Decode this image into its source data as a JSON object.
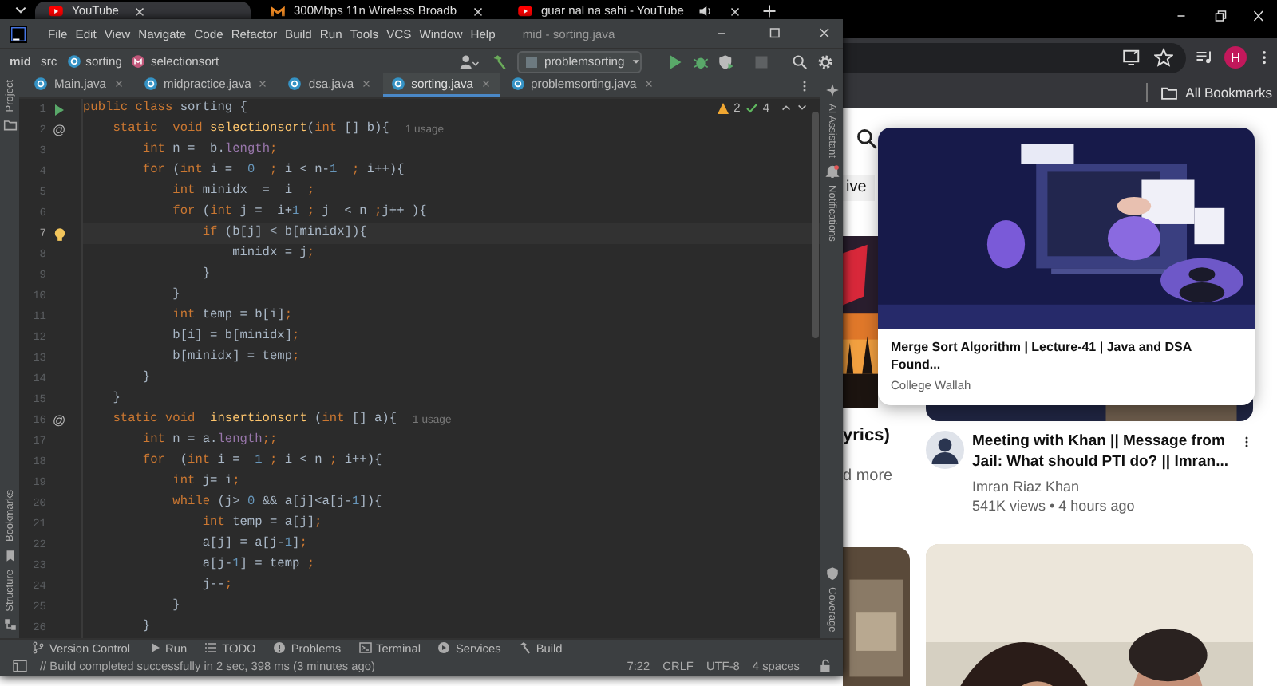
{
  "browser": {
    "tabs": [
      {
        "title": "YouTube",
        "kind": "youtube",
        "selected": true,
        "playing": false
      },
      {
        "title": "300Mbps 11n Wireless Broadb",
        "kind": "site",
        "selected": false,
        "playing": false
      },
      {
        "title": "guar nal na sahi - YouTube",
        "kind": "youtube",
        "selected": false,
        "playing": true
      }
    ],
    "bookmarks": [
      {
        "label": "All Bookmarks"
      }
    ],
    "profile": "H",
    "page": {
      "left_column": [
        {
          "kind": "chip",
          "text": "ive"
        },
        {
          "kind": "picture"
        },
        {
          "kind": "title",
          "text": "yrics)"
        },
        {
          "kind": "more",
          "text": "d more"
        },
        {
          "kind": "picture"
        }
      ],
      "main_column": [
        {
          "kind": "picture"
        },
        {
          "kind": "video",
          "title": "Meeting with Khan || Message from Jail: What should PTI do? || Imran...",
          "channel": "Imran Riaz Khan",
          "meta": "541K views • 4 hours ago"
        },
        {
          "kind": "picture"
        }
      ],
      "hover_card": {
        "title": "Merge Sort Algorithm | Lecture-41 | Java and DSA Found...",
        "channel": "College Wallah"
      }
    }
  },
  "ide": {
    "title": "mid - sorting.java",
    "menu": [
      "File",
      "Edit",
      "View",
      "Navigate",
      "Code",
      "Refactor",
      "Build",
      "Run",
      "Tools",
      "VCS",
      "Window",
      "Help"
    ],
    "breadcrumbs": [
      {
        "label": "mid",
        "kind": "project"
      },
      {
        "label": "src",
        "kind": "folder"
      },
      {
        "label": "sorting",
        "kind": "class"
      },
      {
        "label": "selectionsort",
        "kind": "method"
      }
    ],
    "run_config": "problemsorting",
    "tabs": [
      {
        "label": "Main.java",
        "selected": false
      },
      {
        "label": "midpractice.java",
        "selected": false
      },
      {
        "label": "dsa.java",
        "selected": false
      },
      {
        "label": "sorting.java",
        "selected": true
      },
      {
        "label": "problemsorting.java",
        "selected": false
      }
    ],
    "left_tools": [
      {
        "label": "Project",
        "kind": "project"
      },
      {
        "label": "Bookmarks",
        "kind": "bookmarks"
      },
      {
        "label": "Structure",
        "kind": "structure"
      }
    ],
    "right_tools": [
      {
        "label": "AI Assistant",
        "kind": "ai"
      },
      {
        "label": "Notifications",
        "kind": "notifications"
      },
      {
        "label": "Coverage",
        "kind": "coverage"
      }
    ],
    "inspections": {
      "warnings": "2",
      "passed": "4"
    },
    "lines": [
      {
        "number": "1",
        "kind": "run",
        "current": false,
        "tokens": [
          {
            "kind": "k",
            "text": "public class "
          },
          {
            "kind": "p",
            "text": "sorting {"
          }
        ]
      },
      {
        "number": "2",
        "kind": "plain",
        "current": false,
        "mark": "@",
        "hint": "1 usage",
        "tokens": [
          {
            "kind": "k",
            "text": "    static  void "
          },
          {
            "kind": "m",
            "text": "selectionsort"
          },
          {
            "kind": "p",
            "text": "("
          },
          {
            "kind": "k",
            "text": "int"
          },
          {
            "kind": "p",
            "text": " [] b){"
          }
        ]
      },
      {
        "number": "3",
        "kind": "plain",
        "current": false,
        "tokens": [
          {
            "kind": "k",
            "text": "        int "
          },
          {
            "kind": "p",
            "text": "n =  b."
          },
          {
            "kind": "f",
            "text": "length"
          },
          {
            "kind": "k",
            "text": ";"
          }
        ]
      },
      {
        "number": "4",
        "kind": "plain",
        "current": false,
        "tokens": [
          {
            "kind": "k",
            "text": "        for "
          },
          {
            "kind": "p",
            "text": "("
          },
          {
            "kind": "k",
            "text": "int "
          },
          {
            "kind": "p",
            "text": "i =  "
          },
          {
            "kind": "n",
            "text": "0"
          },
          {
            "kind": "k",
            "text": "  ;"
          },
          {
            "kind": "p",
            "text": " i < n-"
          },
          {
            "kind": "n",
            "text": "1"
          },
          {
            "kind": "k",
            "text": "  ;"
          },
          {
            "kind": "p",
            "text": " i++){"
          }
        ]
      },
      {
        "number": "5",
        "kind": "plain",
        "current": false,
        "tokens": [
          {
            "kind": "k",
            "text": "            int "
          },
          {
            "kind": "p",
            "text": "minidx  =  i  "
          },
          {
            "kind": "k",
            "text": ";"
          }
        ]
      },
      {
        "number": "6",
        "kind": "plain",
        "current": false,
        "tokens": [
          {
            "kind": "k",
            "text": "            for "
          },
          {
            "kind": "p",
            "text": "("
          },
          {
            "kind": "k",
            "text": "int "
          },
          {
            "kind": "p",
            "text": "j =  i+"
          },
          {
            "kind": "n",
            "text": "1"
          },
          {
            "kind": "k",
            "text": " ;"
          },
          {
            "kind": "p",
            "text": " j  < n "
          },
          {
            "kind": "k",
            "text": ";"
          },
          {
            "kind": "p",
            "text": "j++ ){"
          }
        ]
      },
      {
        "number": "7",
        "kind": "bulb",
        "current": true,
        "tokens": [
          {
            "kind": "k",
            "text": "                if "
          },
          {
            "kind": "p",
            "text": "(b[j] < b[minidx]){"
          }
        ]
      },
      {
        "number": "8",
        "kind": "plain",
        "current": false,
        "tokens": [
          {
            "kind": "p",
            "text": "                    minidx = j"
          },
          {
            "kind": "k",
            "text": ";"
          }
        ]
      },
      {
        "number": "9",
        "kind": "plain",
        "current": false,
        "tokens": [
          {
            "kind": "p",
            "text": "                }"
          }
        ]
      },
      {
        "number": "10",
        "kind": "plain",
        "current": false,
        "tokens": [
          {
            "kind": "p",
            "text": "            }"
          }
        ]
      },
      {
        "number": "11",
        "kind": "plain",
        "current": false,
        "tokens": [
          {
            "kind": "k",
            "text": "            int "
          },
          {
            "kind": "p",
            "text": "temp = b[i]"
          },
          {
            "kind": "k",
            "text": ";"
          }
        ]
      },
      {
        "number": "12",
        "kind": "plain",
        "current": false,
        "tokens": [
          {
            "kind": "p",
            "text": "            b[i] = b[minidx]"
          },
          {
            "kind": "k",
            "text": ";"
          }
        ]
      },
      {
        "number": "13",
        "kind": "plain",
        "current": false,
        "tokens": [
          {
            "kind": "p",
            "text": "            b[minidx] = temp"
          },
          {
            "kind": "k",
            "text": ";"
          }
        ]
      },
      {
        "number": "14",
        "kind": "plain",
        "current": false,
        "tokens": [
          {
            "kind": "p",
            "text": "        }"
          }
        ]
      },
      {
        "number": "15",
        "kind": "plain",
        "current": false,
        "tokens": [
          {
            "kind": "p",
            "text": "    }"
          }
        ]
      },
      {
        "number": "16",
        "kind": "plain",
        "current": false,
        "mark": "@",
        "hint": "1 usage",
        "tokens": [
          {
            "kind": "k",
            "text": "    static void  "
          },
          {
            "kind": "m",
            "text": "insertionsort"
          },
          {
            "kind": "p",
            "text": " ("
          },
          {
            "kind": "k",
            "text": "int"
          },
          {
            "kind": "p",
            "text": " [] a){"
          }
        ]
      },
      {
        "number": "17",
        "kind": "plain",
        "current": false,
        "tokens": [
          {
            "kind": "k",
            "text": "        int "
          },
          {
            "kind": "p",
            "text": "n = a."
          },
          {
            "kind": "f",
            "text": "length"
          },
          {
            "kind": "k",
            "text": ";;"
          }
        ]
      },
      {
        "number": "18",
        "kind": "plain",
        "current": false,
        "tokens": [
          {
            "kind": "k",
            "text": "        for  "
          },
          {
            "kind": "p",
            "text": "("
          },
          {
            "kind": "k",
            "text": "int "
          },
          {
            "kind": "p",
            "text": "i =  "
          },
          {
            "kind": "n",
            "text": "1"
          },
          {
            "kind": "k",
            "text": " ;"
          },
          {
            "kind": "p",
            "text": " i < n "
          },
          {
            "kind": "k",
            "text": ";"
          },
          {
            "kind": "p",
            "text": " i++){"
          }
        ]
      },
      {
        "number": "19",
        "kind": "plain",
        "current": false,
        "tokens": [
          {
            "kind": "k",
            "text": "            int "
          },
          {
            "kind": "p",
            "text": "j= i"
          },
          {
            "kind": "k",
            "text": ";"
          }
        ]
      },
      {
        "number": "20",
        "kind": "plain",
        "current": false,
        "tokens": [
          {
            "kind": "k",
            "text": "            while "
          },
          {
            "kind": "p",
            "text": "(j> "
          },
          {
            "kind": "n",
            "text": "0"
          },
          {
            "kind": "p",
            "text": " && a[j]<a[j-"
          },
          {
            "kind": "n",
            "text": "1"
          },
          {
            "kind": "p",
            "text": "]){"
          }
        ]
      },
      {
        "number": "21",
        "kind": "plain",
        "current": false,
        "tokens": [
          {
            "kind": "k",
            "text": "                int "
          },
          {
            "kind": "p",
            "text": "temp = a[j]"
          },
          {
            "kind": "k",
            "text": ";"
          }
        ]
      },
      {
        "number": "22",
        "kind": "plain",
        "current": false,
        "tokens": [
          {
            "kind": "p",
            "text": "                a[j] = a[j-"
          },
          {
            "kind": "n",
            "text": "1"
          },
          {
            "kind": "p",
            "text": "]"
          },
          {
            "kind": "k",
            "text": ";"
          }
        ]
      },
      {
        "number": "23",
        "kind": "plain",
        "current": false,
        "tokens": [
          {
            "kind": "p",
            "text": "                a[j-"
          },
          {
            "kind": "n",
            "text": "1"
          },
          {
            "kind": "p",
            "text": "] = temp "
          },
          {
            "kind": "k",
            "text": ";"
          }
        ]
      },
      {
        "number": "24",
        "kind": "plain",
        "current": false,
        "tokens": [
          {
            "kind": "p",
            "text": "                j--"
          },
          {
            "kind": "k",
            "text": ";"
          }
        ]
      },
      {
        "number": "25",
        "kind": "plain",
        "current": false,
        "tokens": [
          {
            "kind": "p",
            "text": "            }"
          }
        ]
      },
      {
        "number": "26",
        "kind": "plain",
        "current": false,
        "tokens": [
          {
            "kind": "p",
            "text": "        }"
          }
        ]
      }
    ],
    "tool_windows": [
      {
        "label": "Version Control",
        "kind": "vcs"
      },
      {
        "label": "Run",
        "kind": "run"
      },
      {
        "label": "TODO",
        "kind": "todo"
      },
      {
        "label": "Problems",
        "kind": "problems"
      },
      {
        "label": "Terminal",
        "kind": "terminal"
      },
      {
        "label": "Services",
        "kind": "services"
      },
      {
        "label": "Build",
        "kind": "build"
      }
    ],
    "status": {
      "message": "// Build completed successfully in 2 sec, 398 ms (3 minutes ago)",
      "position": "7:22",
      "line_separator": "CRLF",
      "encoding": "UTF-8",
      "indent": "4 spaces"
    }
  }
}
